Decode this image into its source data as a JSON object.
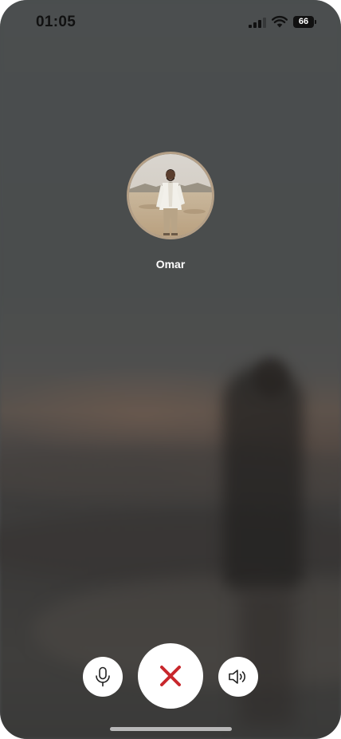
{
  "status_bar": {
    "time": "01:05",
    "battery": "66",
    "icons": [
      "signal-icon",
      "wifi-icon",
      "battery-icon"
    ]
  },
  "call": {
    "caller_name": "Omar",
    "avatar": "caller-avatar-photo"
  },
  "controls": {
    "mic": "microphone-icon",
    "end_call": "close-icon",
    "speaker": "speaker-icon",
    "end_call_color": "#c8272c"
  }
}
